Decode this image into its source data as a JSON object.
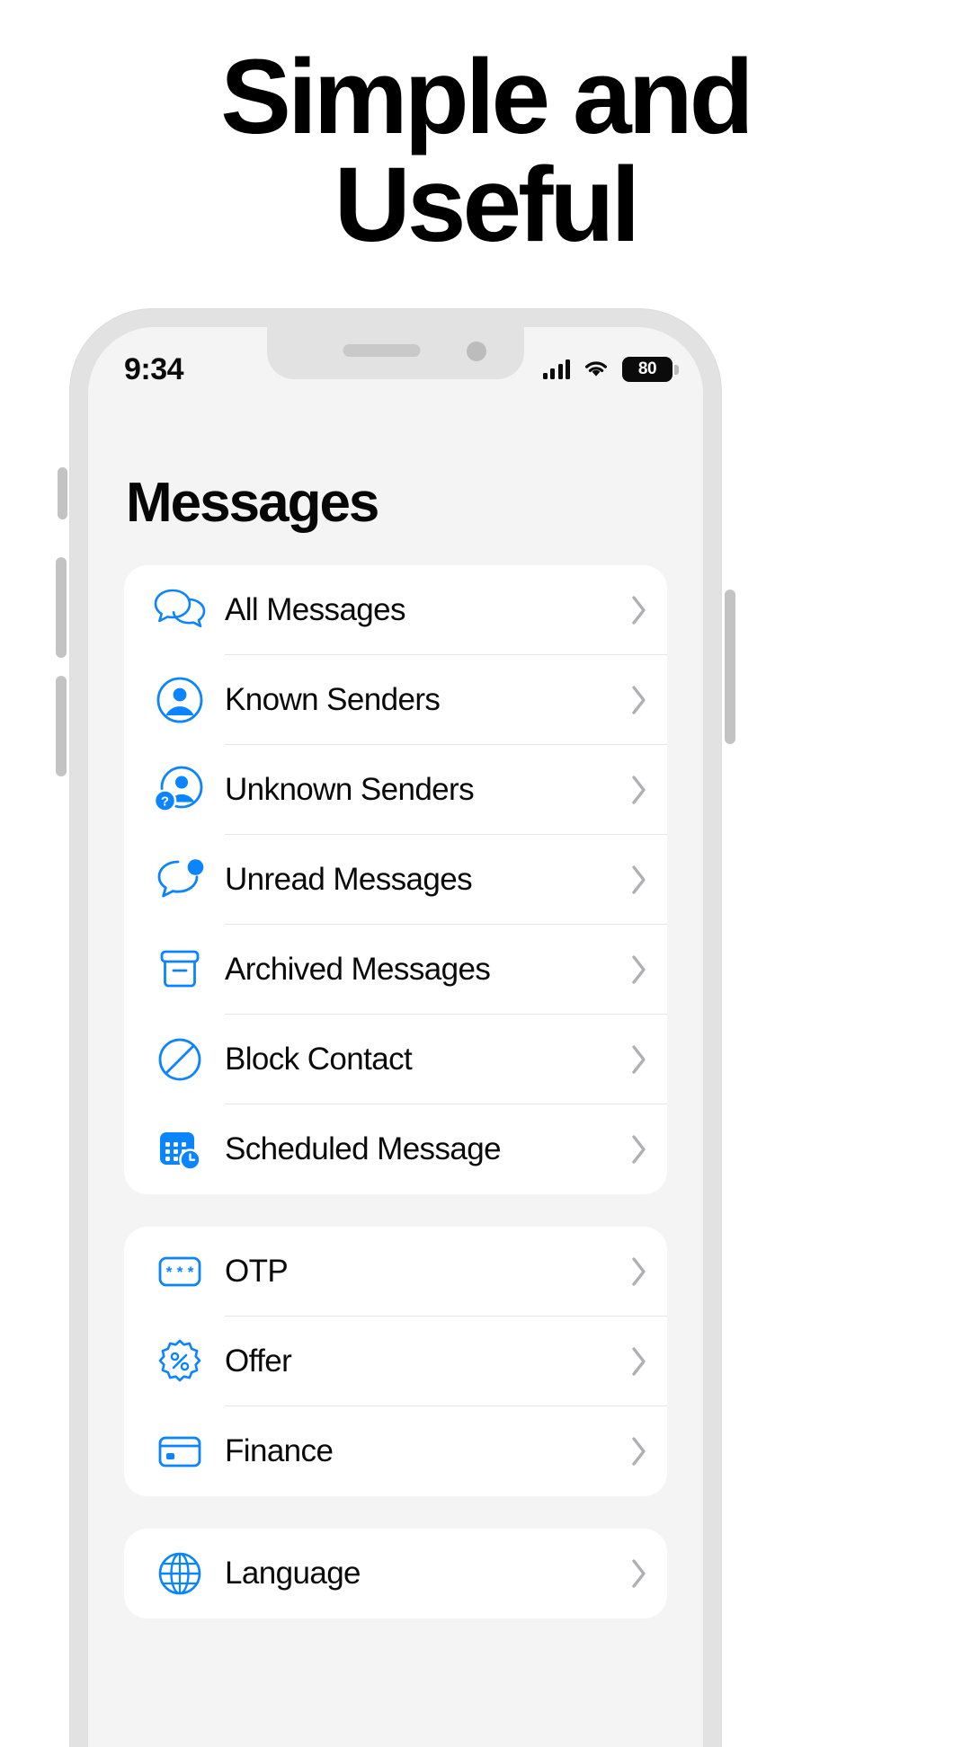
{
  "headline": {
    "line1": "Simple and",
    "line2": "Useful"
  },
  "phone": {
    "statusbar": {
      "time": "9:34",
      "cellular_icon": "cellular-bars-icon",
      "wifi_icon": "wifi-icon",
      "battery_level": "80"
    },
    "app": {
      "title": "Messages",
      "accent_color": "#0a84ff",
      "chevron_color": "#b0b0b4",
      "groups": [
        {
          "items": [
            {
              "label": "All Messages",
              "icon": "chat-bubbles-icon"
            },
            {
              "label": "Known Senders",
              "icon": "person-circle-icon"
            },
            {
              "label": "Unknown Senders",
              "icon": "person-question-icon"
            },
            {
              "label": "Unread Messages",
              "icon": "bubble-badge-icon"
            },
            {
              "label": "Archived Messages",
              "icon": "archive-box-icon"
            },
            {
              "label": "Block Contact",
              "icon": "block-circle-icon"
            },
            {
              "label": "Scheduled Message",
              "icon": "calendar-clock-icon"
            }
          ]
        },
        {
          "items": [
            {
              "label": "OTP",
              "icon": "asterisk-code-icon"
            },
            {
              "label": "Offer",
              "icon": "percent-badge-icon"
            },
            {
              "label": "Finance",
              "icon": "credit-card-icon"
            }
          ]
        },
        {
          "items": [
            {
              "label": "Language",
              "icon": "globe-icon"
            }
          ]
        }
      ]
    }
  }
}
